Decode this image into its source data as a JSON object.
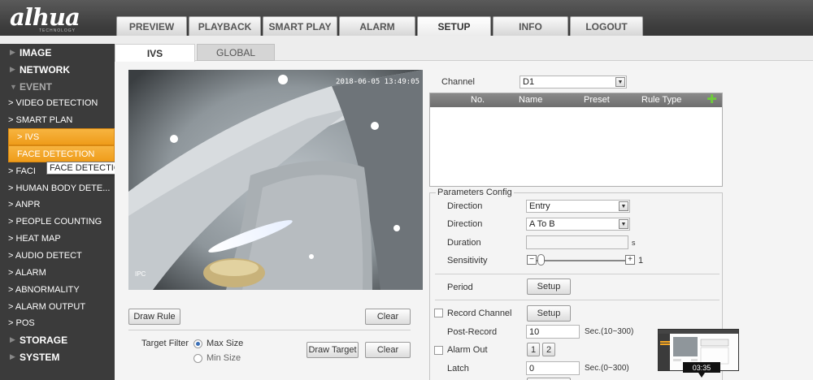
{
  "brand": {
    "logo": "alhua",
    "tagline": "TECHNOLOGY"
  },
  "nav": {
    "tabs": [
      {
        "label": "PREVIEW"
      },
      {
        "label": "PLAYBACK"
      },
      {
        "label": "SMART PLAY"
      },
      {
        "label": "ALARM"
      },
      {
        "label": "SETUP"
      },
      {
        "label": "INFO"
      },
      {
        "label": "LOGOUT"
      }
    ],
    "active": "SETUP"
  },
  "sidebar": {
    "items": [
      {
        "label": "IMAGE"
      },
      {
        "label": "NETWORK"
      },
      {
        "label": "EVENT"
      },
      {
        "label": "> VIDEO DETECTION"
      },
      {
        "label": "> SMART PLAN"
      },
      {
        "label": "> IVS"
      },
      {
        "label": "FACE DETECTION"
      },
      {
        "label": "> FACI"
      },
      {
        "label": "> HUMAN BODY DETE..."
      },
      {
        "label": "> ANPR"
      },
      {
        "label": "> PEOPLE COUNTING"
      },
      {
        "label": "> HEAT MAP"
      },
      {
        "label": "> AUDIO DETECT"
      },
      {
        "label": "> ALARM"
      },
      {
        "label": "> ABNORMALITY"
      },
      {
        "label": "> ALARM OUTPUT"
      },
      {
        "label": "> POS"
      },
      {
        "label": "STORAGE"
      },
      {
        "label": "SYSTEM"
      }
    ],
    "tooltip": "FACE DETECTION"
  },
  "subtabs": {
    "ivs": "IVS",
    "global": "GLOBAL"
  },
  "video": {
    "timestamp": "2018-06-05 13:49:05",
    "camera": "IPC"
  },
  "left_controls": {
    "draw_rule": "Draw Rule",
    "clear1": "Clear",
    "target_filter": "Target Filter",
    "max_size": "Max Size",
    "min_size": "Min Size",
    "draw_target": "Draw Target",
    "clear2": "Clear"
  },
  "right_panel": {
    "channel_label": "Channel",
    "channel_value": "D1",
    "table_headers": {
      "no": "No.",
      "name": "Name",
      "preset": "Preset",
      "rule_type": "Rule Type"
    },
    "params_title": "Parameters Config",
    "direction1_label": "Direction",
    "direction1_value": "Entry",
    "direction2_label": "Direction",
    "direction2_value": "A To B",
    "duration_label": "Duration",
    "duration_unit": "s",
    "sensitivity_label": "Sensitivity",
    "sensitivity_minus": "−",
    "sensitivity_plus": "+",
    "sensitivity_value": "1",
    "period_label": "Period",
    "period_button": "Setup",
    "record_channel_label": "Record Channel",
    "record_channel_button": "Setup",
    "post_record_label": "Post-Record",
    "post_record_value": "10",
    "post_record_range": "Sec.(10~300)",
    "alarm_out_label": "Alarm Out",
    "alarm_out_1": "1",
    "alarm_out_2": "2",
    "latch_label": "Latch",
    "latch_value": "0",
    "latch_range": "Sec.(0~300)"
  },
  "thumbnail": {
    "time": "03:35"
  },
  "colors": {
    "highlight": "#f5a623",
    "header": "#3d3d3d",
    "sidebar": "#3b3b3b"
  }
}
